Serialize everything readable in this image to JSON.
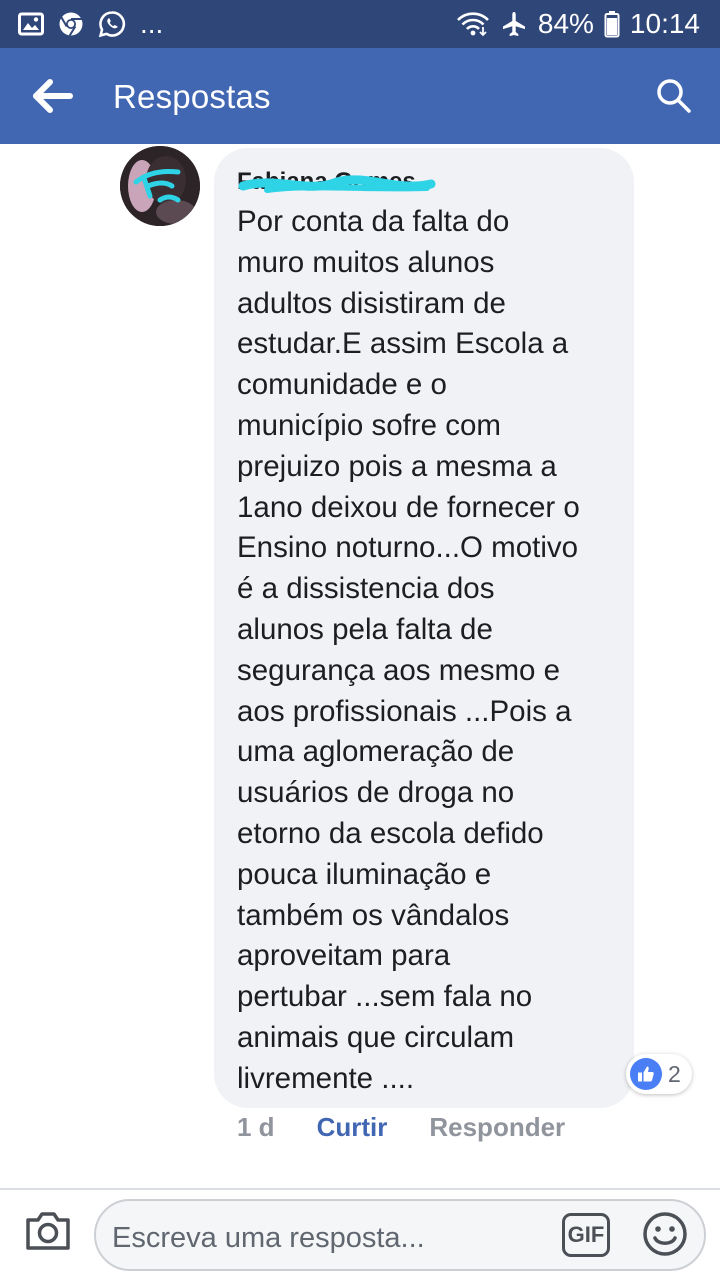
{
  "status_bar": {
    "battery": "84%",
    "time": "10:14",
    "more": "..."
  },
  "header": {
    "title": "Respostas"
  },
  "comment": {
    "author": "Fabiana Gomes",
    "text": "Por conta da falta do\nmuro muitos alunos\nadultos disistiram de\nestudar.E assim  Escola  a\ncomunidade e o\nmunicípio sofre com\nprejuizo pois a mesma a\n1ano deixou de fornecer o\nEnsino noturno...O motivo\né a dissistencia dos\nalunos pela falta de\nsegurança aos mesmo e\naos profissionais ...Pois a\numa aglomeração de\nusuários de droga no\netorno da escola defido\npouca iluminação e\ntambém os vândalos\naproveitam para\npertubar ...sem fala no\nanimais que circulam\nlivremente ....",
    "reaction_count": "2",
    "time_ago": "1 d",
    "like_label": "Curtir",
    "reply_label": "Responder"
  },
  "composer": {
    "placeholder": "Escreva uma resposta...",
    "gif_label": "GIF"
  },
  "colors": {
    "status_bar": "#2f4678",
    "app_bar": "#4267b2",
    "bubble": "#f1f2f6",
    "like_blue": "#4267b2",
    "redaction": "#2ed3e6"
  }
}
